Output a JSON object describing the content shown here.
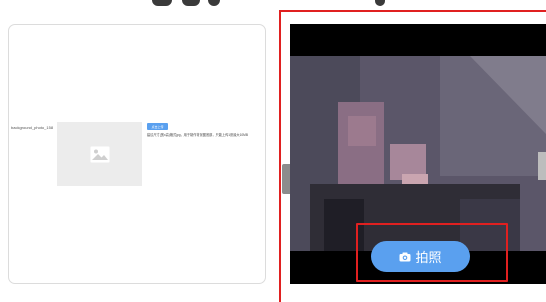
{
  "upload": {
    "field_label": "background_photo_158",
    "button_label": "点击上传",
    "hint": "建议尺寸(宽x高)格式jpg，用于制作背景图底部，只能上传1张最大10MB"
  },
  "camera": {
    "capture_label": "拍照",
    "capture_icon": "camera-icon"
  },
  "colors": {
    "accent": "#5aa0ef",
    "highlight": "#e02020"
  }
}
